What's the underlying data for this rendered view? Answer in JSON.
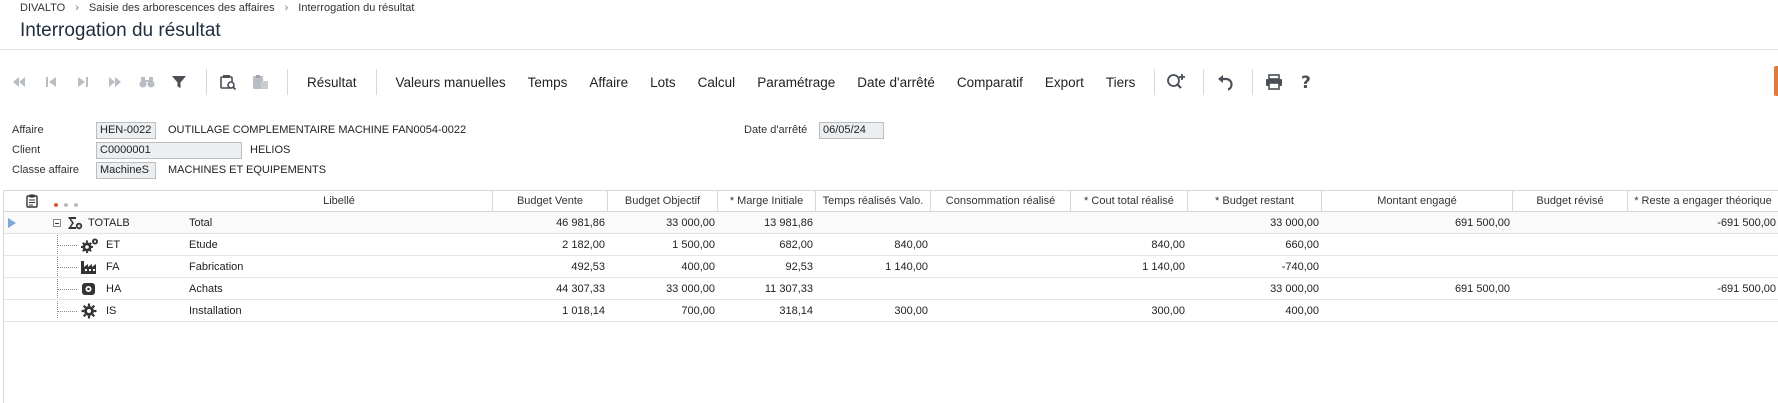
{
  "breadcrumb": [
    "DIVALTO",
    "Saisie des arborescences des affaires",
    "Interrogation du résultat"
  ],
  "page_title": "Interrogation du résultat",
  "toolbar": {
    "nav_icons": [
      "first-icon",
      "previous-icon",
      "next-icon",
      "last-icon",
      "binoculars-icon",
      "filter-icon"
    ],
    "doc_icons": [
      "document-search-icon",
      "paste-icon"
    ],
    "buttons": [
      "Résultat",
      "Valeurs manuelles",
      "Temps",
      "Affaire",
      "Lots",
      "Calcul",
      "Paramétrage",
      "Date d'arrêté",
      "Comparatif",
      "Export",
      "Tiers"
    ],
    "right_icons": [
      "zoom-in-icon",
      "undo-icon",
      "print-icon",
      "help-icon"
    ]
  },
  "form": {
    "affaire_label": "Affaire",
    "affaire_code": "HEN-0022",
    "affaire_desc": "OUTILLAGE COMPLEMENTAIRE MACHINE FAN0054-0022",
    "client_label": "Client",
    "client_code": "C0000001",
    "client_name": "HELIOS",
    "classe_label": "Classe affaire",
    "classe_code": "MachineS",
    "classe_desc": "MACHINES ET EQUIPEMENTS",
    "date_label": "Date d'arrêté",
    "date_value": "06/05/24"
  },
  "grid": {
    "columns": [
      "Libellé",
      "Budget Vente",
      "Budget Objectif",
      "* Marge Initiale",
      "Temps réalisés Valo.",
      "Consommation réalisé",
      "* Cout total réalisé",
      "* Budget restant",
      "Montant engagé",
      "Budget révisé",
      "* Reste a engager théorique"
    ],
    "rows": [
      {
        "code": "TOTALB",
        "icon": "sum-icon",
        "libelle": "Total",
        "v": [
          "46 981,86",
          "33 000,00",
          "13 981,86",
          "",
          "",
          "",
          "33 000,00",
          "691 500,00",
          "",
          "-691 500,00"
        ]
      },
      {
        "code": "ET",
        "icon": "gears-icon",
        "libelle": "Etude",
        "v": [
          "2 182,00",
          "1 500,00",
          "682,00",
          "840,00",
          "",
          "840,00",
          "660,00",
          "",
          "",
          ""
        ]
      },
      {
        "code": "FA",
        "icon": "factory-icon",
        "libelle": "Fabrication",
        "v": [
          "492,53",
          "400,00",
          "92,53",
          "1 140,00",
          "",
          "1 140,00",
          "-740,00",
          "",
          "",
          ""
        ]
      },
      {
        "code": "HA",
        "icon": "purchase-icon",
        "libelle": "Achats",
        "v": [
          "44 307,33",
          "33 000,00",
          "11 307,33",
          "",
          "",
          "",
          "33 000,00",
          "691 500,00",
          "",
          "-691 500,00"
        ]
      },
      {
        "code": "IS",
        "icon": "gear-icon",
        "libelle": "Installation",
        "v": [
          "1 018,14",
          "700,00",
          "318,14",
          "300,00",
          "",
          "300,00",
          "400,00",
          "",
          "",
          ""
        ]
      }
    ]
  }
}
